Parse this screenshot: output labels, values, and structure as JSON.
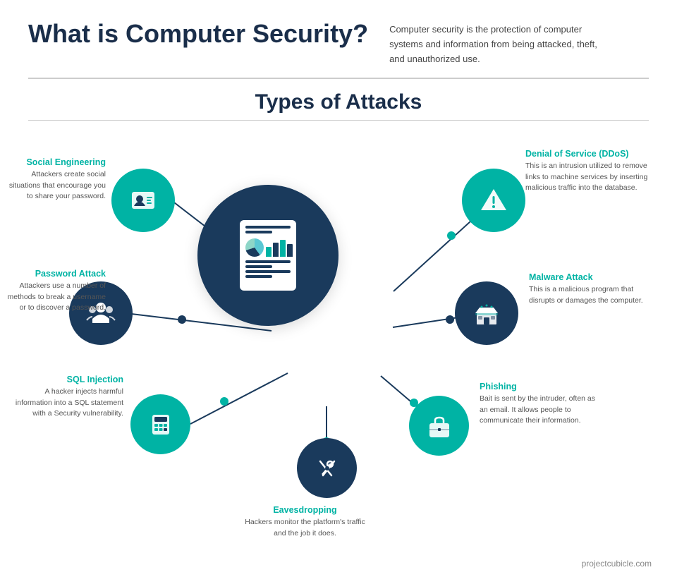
{
  "header": {
    "title": "What is Computer Security?",
    "description": "Computer security is the protection of computer systems and information from being attacked, theft, and unauthorized use."
  },
  "section_title": "Types of Attacks",
  "attacks": [
    {
      "id": "social-engineering",
      "title": "Social Engineering",
      "description": "Attackers create social situations that encourage you to share your password.",
      "icon": "person-card",
      "color": "teal",
      "position": "top-left"
    },
    {
      "id": "password-attack",
      "title": "Password Attack",
      "description": "Attackers use a number of methods to break a username or to discover a password.",
      "icon": "group",
      "color": "navy",
      "position": "mid-left"
    },
    {
      "id": "sql-injection",
      "title": "SQL Injection",
      "description": "A hacker injects harmful information into a SQL statement with a Security vulnerability.",
      "icon": "calculator",
      "color": "teal",
      "position": "bot-left"
    },
    {
      "id": "eavesdropping",
      "title": "Eavesdropping",
      "description": "Hackers monitor the platform's traffic and the job it does.",
      "icon": "tools",
      "color": "navy",
      "position": "bottom"
    },
    {
      "id": "phishing",
      "title": "Phishing",
      "description": "Bait is sent by the intruder, often as an email. It allows people to communicate their information.",
      "icon": "briefcase",
      "color": "teal",
      "position": "bot-right"
    },
    {
      "id": "malware-attack",
      "title": "Malware Attack",
      "description": "This is a malicious program that disrupts or damages the computer.",
      "icon": "store",
      "color": "navy",
      "position": "mid-right"
    },
    {
      "id": "ddos",
      "title": "Denial of Service (DDoS)",
      "description": "This is an intrusion utilized to remove links to machine services by inserting malicious traffic into the database.",
      "icon": "warning",
      "color": "teal",
      "position": "top-right"
    }
  ],
  "footer": {
    "url": "projectcubicle.com"
  },
  "colors": {
    "teal": "#00b3a4",
    "navy": "#1a3a5c",
    "text_dark": "#1a2e4a",
    "text_gray": "#555555"
  }
}
